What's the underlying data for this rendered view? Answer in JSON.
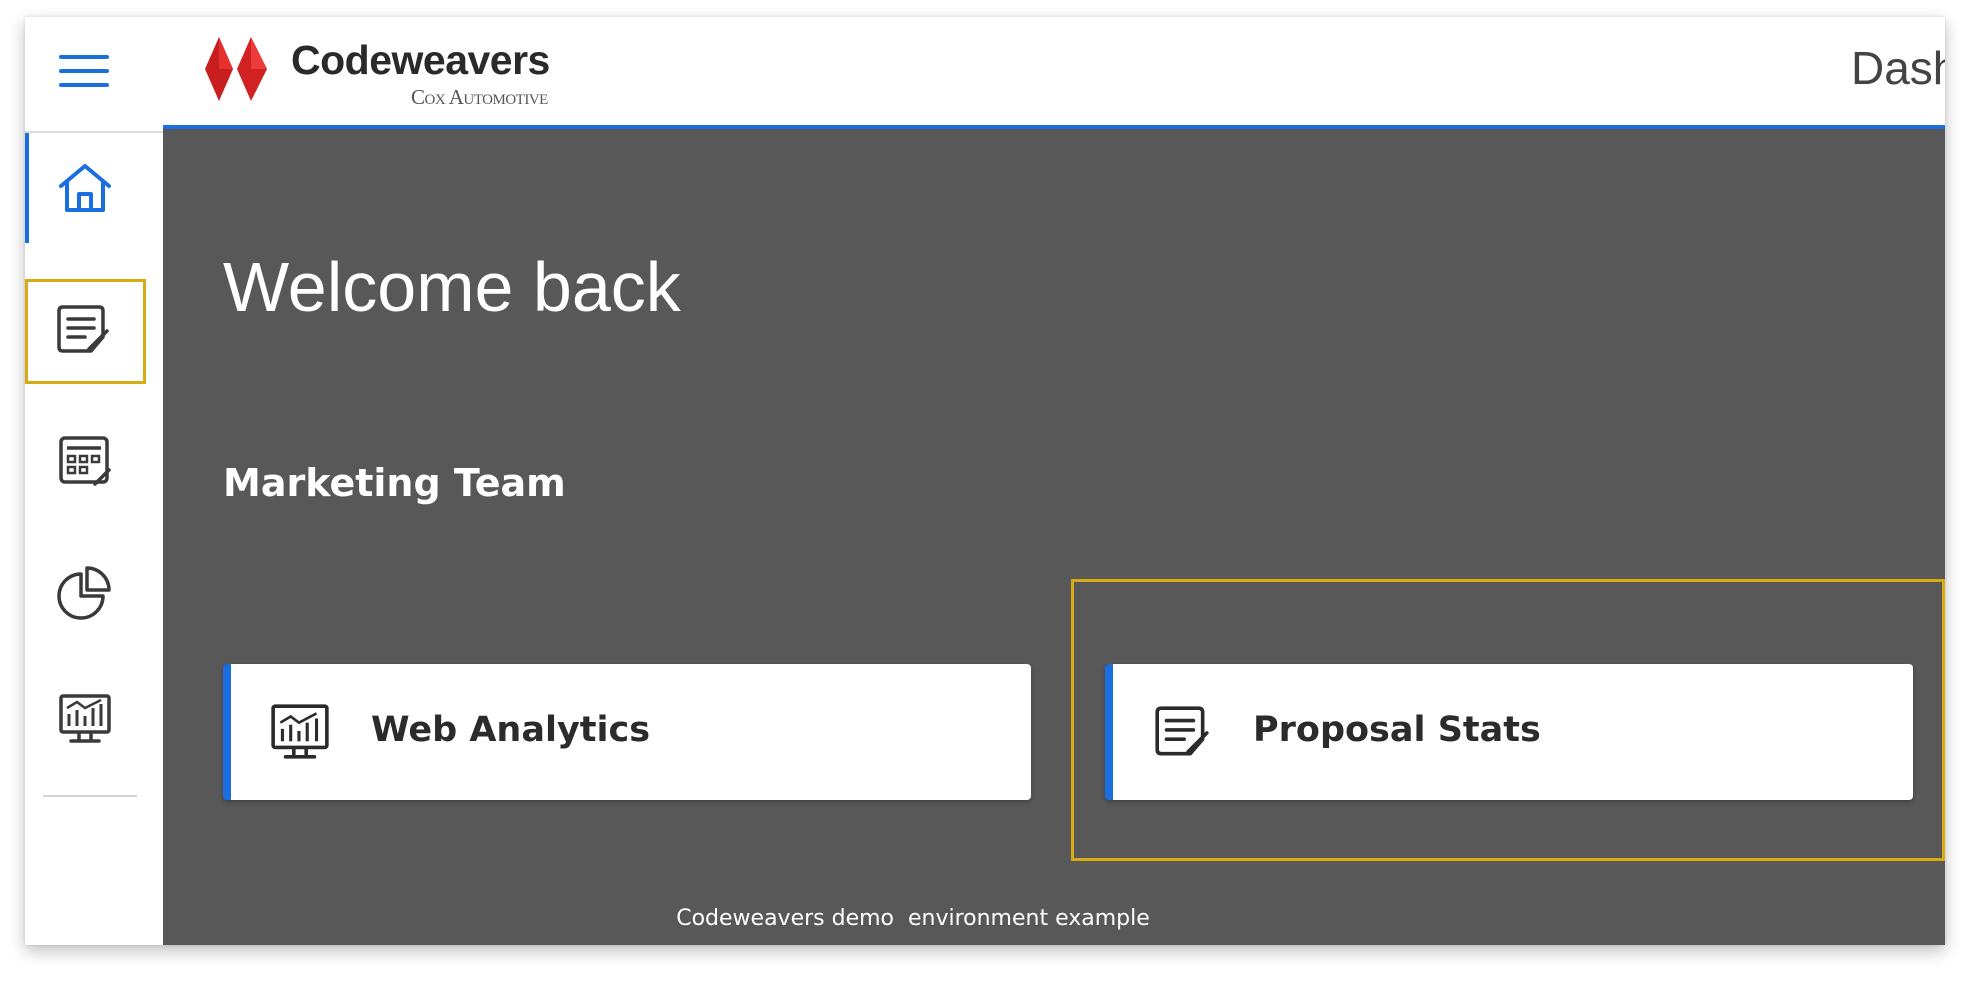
{
  "header": {
    "brand_name": "Codeweavers",
    "brand_sub": "Cox Automotive",
    "page_title": "Dashboard",
    "colors": {
      "accent": "#1a6fe0",
      "logo_red": "#e02020",
      "highlight": "#d8ab12"
    }
  },
  "sidebar": {
    "menu_icon": "hamburger-menu-icon",
    "items": [
      {
        "icon": "home-icon",
        "active": true
      },
      {
        "icon": "proposal-icon",
        "highlighted": true
      },
      {
        "icon": "calculator-icon"
      },
      {
        "icon": "pie-chart-icon"
      },
      {
        "icon": "analytics-monitor-icon"
      }
    ]
  },
  "main": {
    "welcome": "Welcome back",
    "team": "Marketing Team",
    "cards": [
      {
        "label": "Web Analytics",
        "icon": "analytics-monitor-icon"
      },
      {
        "label": "Proposal Stats",
        "icon": "proposal-icon",
        "highlighted": true
      }
    ],
    "background": "#585858"
  },
  "footer": {
    "text": "Codeweavers demo  environment example"
  }
}
